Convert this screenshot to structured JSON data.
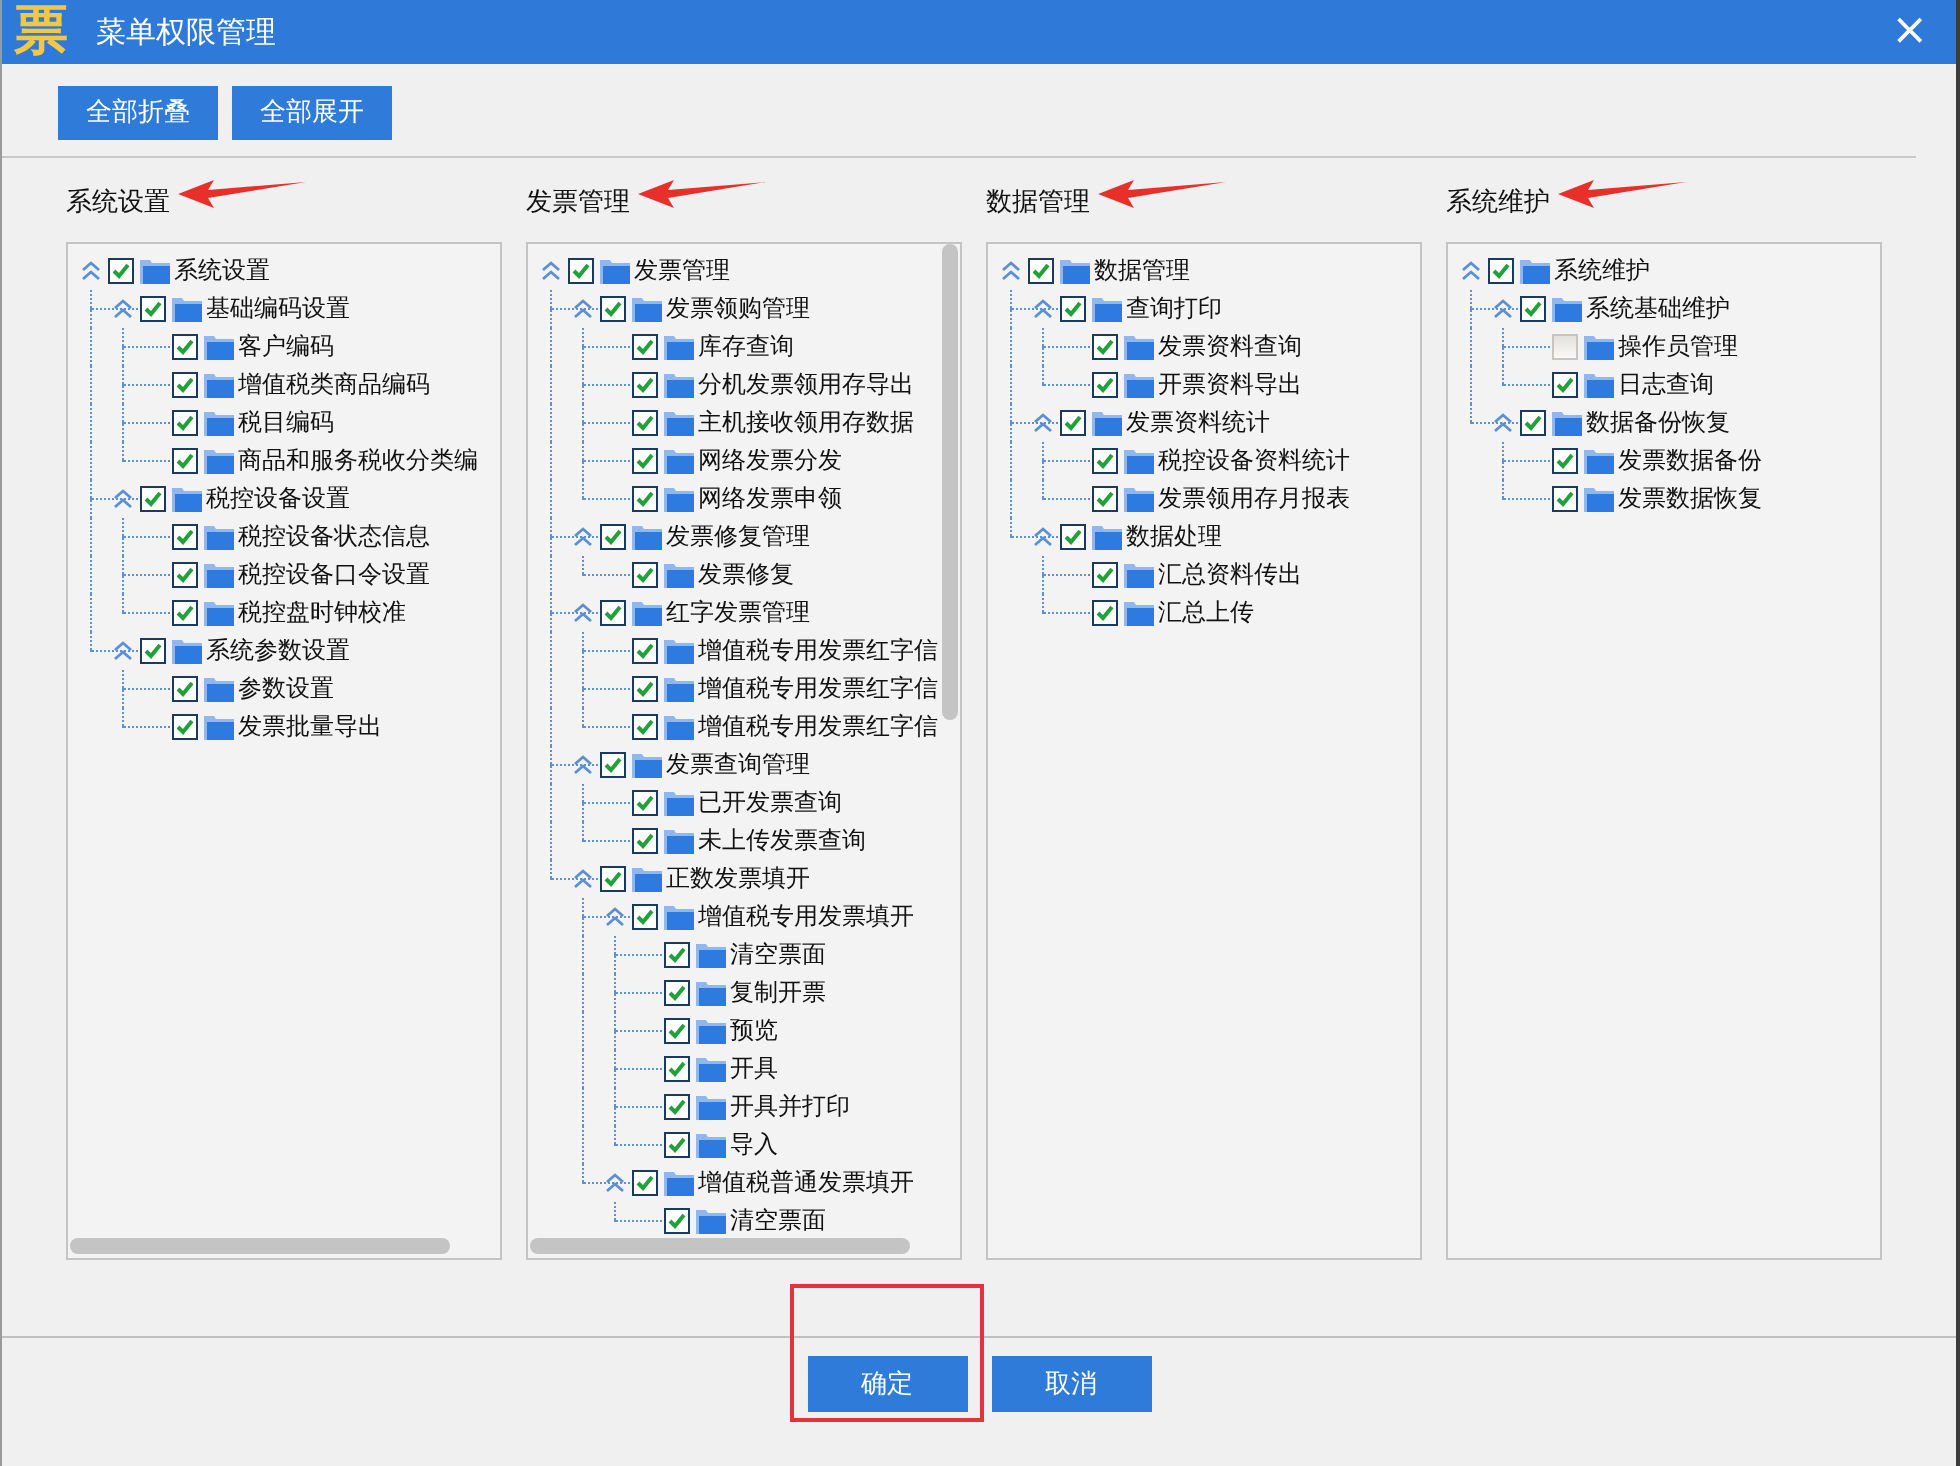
{
  "window": {
    "logo": "票",
    "title": "菜单权限管理",
    "close": "×"
  },
  "toolbar": [
    {
      "label": "全部折叠"
    },
    {
      "label": "全部展开"
    }
  ],
  "sections": [
    {
      "title": "系统设置",
      "arrow": true,
      "horizontal_scrollbar": true,
      "tree": [
        {
          "label": "系统设置",
          "checked": true,
          "expanded": true,
          "children": [
            {
              "label": "基础编码设置",
              "checked": true,
              "expanded": true,
              "children": [
                {
                  "label": "客户编码",
                  "checked": true
                },
                {
                  "label": "增值税类商品编码",
                  "checked": true
                },
                {
                  "label": "税目编码",
                  "checked": true
                },
                {
                  "label": "商品和服务税收分类编",
                  "checked": true
                }
              ]
            },
            {
              "label": "税控设备设置",
              "checked": true,
              "expanded": true,
              "children": [
                {
                  "label": "税控设备状态信息",
                  "checked": true
                },
                {
                  "label": "税控设备口令设置",
                  "checked": true
                },
                {
                  "label": "税控盘时钟校准",
                  "checked": true
                }
              ]
            },
            {
              "label": "系统参数设置",
              "checked": true,
              "expanded": true,
              "children": [
                {
                  "label": "参数设置",
                  "checked": true
                },
                {
                  "label": "发票批量导出",
                  "checked": true
                }
              ]
            }
          ]
        }
      ]
    },
    {
      "title": "发票管理",
      "arrow": true,
      "horizontal_scrollbar": true,
      "vertical_scrollbar": true,
      "tree": [
        {
          "label": "发票管理",
          "checked": true,
          "expanded": true,
          "children": [
            {
              "label": "发票领购管理",
              "checked": true,
              "expanded": true,
              "children": [
                {
                  "label": "库存查询",
                  "checked": true
                },
                {
                  "label": "分机发票领用存导出",
                  "checked": true
                },
                {
                  "label": "主机接收领用存数据",
                  "checked": true
                },
                {
                  "label": "网络发票分发",
                  "checked": true
                },
                {
                  "label": "网络发票申领",
                  "checked": true
                }
              ]
            },
            {
              "label": "发票修复管理",
              "checked": true,
              "expanded": true,
              "children": [
                {
                  "label": "发票修复",
                  "checked": true
                }
              ]
            },
            {
              "label": "红字发票管理",
              "checked": true,
              "expanded": true,
              "children": [
                {
                  "label": "增值税专用发票红字信",
                  "checked": true
                },
                {
                  "label": "增值税专用发票红字信",
                  "checked": true
                },
                {
                  "label": "增值税专用发票红字信",
                  "checked": true
                }
              ]
            },
            {
              "label": "发票查询管理",
              "checked": true,
              "expanded": true,
              "children": [
                {
                  "label": "已开发票查询",
                  "checked": true
                },
                {
                  "label": "未上传发票查询",
                  "checked": true
                }
              ]
            },
            {
              "label": "正数发票填开",
              "checked": true,
              "expanded": true,
              "children": [
                {
                  "label": "增值税专用发票填开",
                  "checked": true,
                  "expanded": true,
                  "children": [
                    {
                      "label": "清空票面",
                      "checked": true
                    },
                    {
                      "label": "复制开票",
                      "checked": true
                    },
                    {
                      "label": "预览",
                      "checked": true
                    },
                    {
                      "label": "开具",
                      "checked": true
                    },
                    {
                      "label": "开具并打印",
                      "checked": true
                    },
                    {
                      "label": "导入",
                      "checked": true
                    }
                  ]
                },
                {
                  "label": "增值税普通发票填开",
                  "checked": true,
                  "expanded": true,
                  "children": [
                    {
                      "label": "清空票面",
                      "checked": true
                    }
                  ]
                }
              ]
            }
          ]
        }
      ]
    },
    {
      "title": "数据管理",
      "arrow": true,
      "tree": [
        {
          "label": "数据管理",
          "checked": true,
          "expanded": true,
          "children": [
            {
              "label": "查询打印",
              "checked": true,
              "expanded": true,
              "children": [
                {
                  "label": "发票资料查询",
                  "checked": true
                },
                {
                  "label": "开票资料导出",
                  "checked": true
                }
              ]
            },
            {
              "label": "发票资料统计",
              "checked": true,
              "expanded": true,
              "children": [
                {
                  "label": "税控设备资料统计",
                  "checked": true
                },
                {
                  "label": "发票领用存月报表",
                  "checked": true
                }
              ]
            },
            {
              "label": "数据处理",
              "checked": true,
              "expanded": true,
              "children": [
                {
                  "label": "汇总资料传出",
                  "checked": true
                },
                {
                  "label": "汇总上传",
                  "checked": true
                }
              ]
            }
          ]
        }
      ]
    },
    {
      "title": "系统维护",
      "arrow": true,
      "tree": [
        {
          "label": "系统维护",
          "checked": true,
          "expanded": true,
          "children": [
            {
              "label": "系统基础维护",
              "checked": true,
              "expanded": true,
              "children": [
                {
                  "label": "操作员管理",
                  "checked": false
                },
                {
                  "label": "日志查询",
                  "checked": true
                }
              ]
            },
            {
              "label": "数据备份恢复",
              "checked": true,
              "expanded": true,
              "children": [
                {
                  "label": "发票数据备份",
                  "checked": true
                },
                {
                  "label": "发票数据恢复",
                  "checked": true
                }
              ]
            }
          ]
        }
      ]
    }
  ],
  "footer": {
    "buttons": [
      {
        "label": "确定",
        "highlighted": true
      },
      {
        "label": "取消"
      }
    ]
  }
}
